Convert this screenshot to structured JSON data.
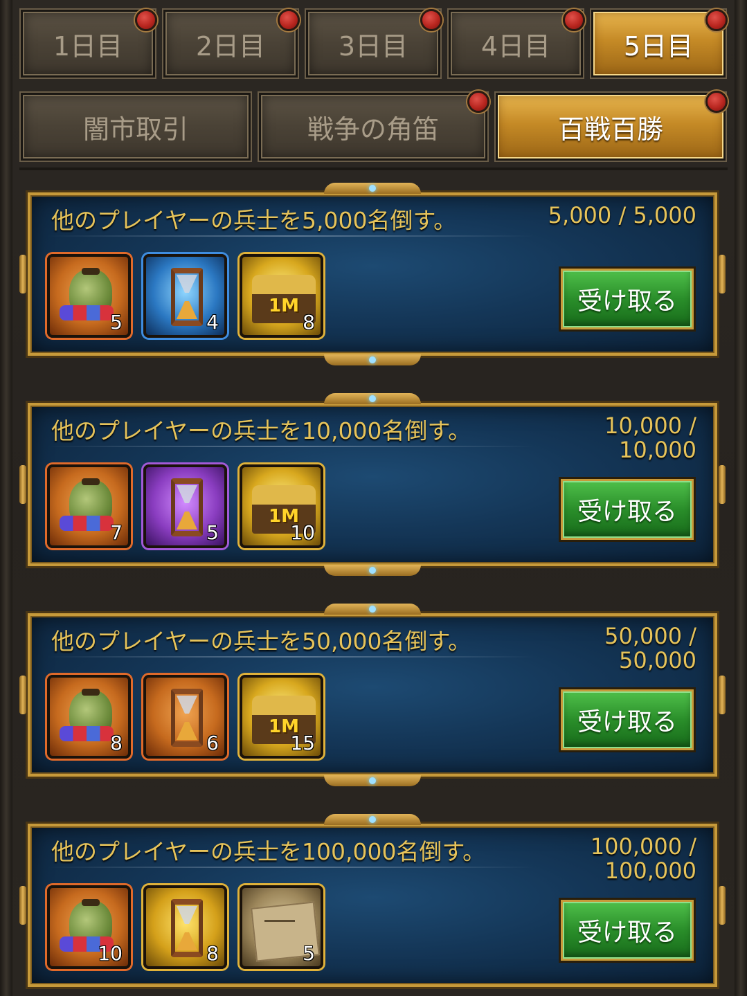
{
  "day_tabs": [
    {
      "label": "1日目",
      "active": false
    },
    {
      "label": "2日目",
      "active": false
    },
    {
      "label": "3日目",
      "active": false
    },
    {
      "label": "4日目",
      "active": false
    },
    {
      "label": "5日目",
      "active": true
    }
  ],
  "category_tabs": [
    {
      "label": "闇市取引",
      "active": false
    },
    {
      "label": "戦争の角笛",
      "active": false
    },
    {
      "label": "百戦百勝",
      "active": true
    }
  ],
  "quests": [
    {
      "title": "他のプレイヤーの兵士を5,000名倒す。",
      "progress": "5,000 / 5,000",
      "claim_label": "受け取る",
      "rewards": [
        {
          "icon": "gem-bag-icon",
          "count": "5"
        },
        {
          "icon": "speedup-hourglass-icon",
          "count": "4"
        },
        {
          "icon": "gold-chest-1m-icon",
          "label": "1M",
          "count": "8"
        }
      ]
    },
    {
      "title": "他のプレイヤーの兵士を10,000名倒す。",
      "progress": "10,000 / 10,000",
      "claim_label": "受け取る",
      "rewards": [
        {
          "icon": "gem-bag-icon",
          "count": "7"
        },
        {
          "icon": "speedup-hourglass-icon",
          "count": "5"
        },
        {
          "icon": "gold-chest-1m-icon",
          "label": "1M",
          "count": "10"
        }
      ]
    },
    {
      "title": "他のプレイヤーの兵士を50,000名倒す。",
      "progress": "50,000 / 50,000",
      "claim_label": "受け取る",
      "rewards": [
        {
          "icon": "gem-bag-icon",
          "count": "8"
        },
        {
          "icon": "speedup-hourglass-icon",
          "count": "6"
        },
        {
          "icon": "gold-chest-1m-icon",
          "label": "1M",
          "count": "15"
        }
      ]
    },
    {
      "title": "他のプレイヤーの兵士を100,000名倒す。",
      "progress": "100,000 / 100,000",
      "claim_label": "受け取る",
      "rewards": [
        {
          "icon": "gem-bag-icon",
          "count": "10"
        },
        {
          "icon": "speedup-hourglass-icon",
          "count": "8"
        },
        {
          "icon": "map-scroll-icon",
          "count": "5"
        }
      ]
    }
  ]
}
